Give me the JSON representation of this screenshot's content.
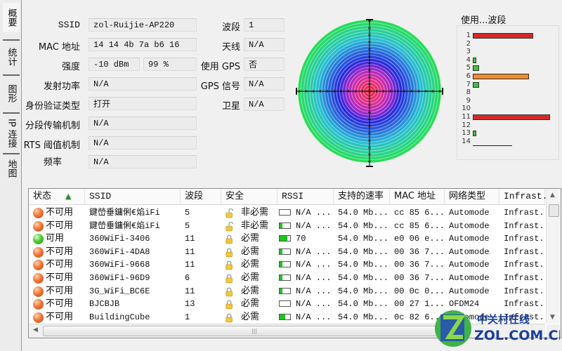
{
  "tabs": [
    {
      "label": "概要",
      "active": true
    },
    {
      "label": "统计",
      "active": false
    },
    {
      "label": "图形",
      "active": false
    },
    {
      "label": "IP 连接",
      "active": false
    },
    {
      "label": "地图",
      "active": false
    }
  ],
  "info": {
    "ssid_label": "SSID",
    "ssid": "zol-Ruijie-AP220",
    "mac_label": "MAC 地址",
    "mac": "14 14 4b 7a b6 16",
    "strength_label": "强度",
    "strength_dbm": "-10 dBm",
    "strength_pct": "99 %",
    "tx_label": "发射功率",
    "tx": "N/A",
    "auth_label": "身份验证类型",
    "auth": "打开",
    "frag_label": "分段传输机制",
    "frag": "N/A",
    "rts_label": "RTS 阈值机制",
    "rts": "N/A",
    "freq_label": "频率",
    "freq": "N/A",
    "channel_label": "波段",
    "channel": "1",
    "antenna_label": "天线",
    "antenna": "N/A",
    "gps_label": "使用 GPS",
    "gps": "否",
    "gps_signal_label": "GPS 信号",
    "gps_signal": "N/A",
    "sat_label": "卫星",
    "sat": "N/A"
  },
  "channel_usage": {
    "title": "使用...波段",
    "channels": [
      {
        "ch": "1",
        "usage": 0.55,
        "color": "#d62828"
      },
      {
        "ch": "2",
        "usage": 0,
        "color": ""
      },
      {
        "ch": "3",
        "usage": 0,
        "color": ""
      },
      {
        "ch": "4",
        "usage": 0.02,
        "color": "#3fc23f"
      },
      {
        "ch": "5",
        "usage": 0.06,
        "color": "#3fc23f"
      },
      {
        "ch": "6",
        "usage": 0.51,
        "color": "#ef8c2c"
      },
      {
        "ch": "7",
        "usage": 0.06,
        "color": "#3fc23f"
      },
      {
        "ch": "8",
        "usage": 0,
        "color": ""
      },
      {
        "ch": "9",
        "usage": 0,
        "color": ""
      },
      {
        "ch": "10",
        "usage": 0,
        "color": ""
      },
      {
        "ch": "11",
        "usage": 0.7,
        "color": "#d62828"
      },
      {
        "ch": "12",
        "usage": 0,
        "color": ""
      },
      {
        "ch": "13",
        "usage": 0.02,
        "color": "#3fc23f"
      },
      {
        "ch": "14",
        "usage": 0,
        "color": ""
      }
    ]
  },
  "list": {
    "columns": [
      "状态",
      "SSID",
      "波段",
      "安全",
      "RSSI",
      "支持的速率",
      "MAC 地址",
      "网络类型",
      "Infrast..."
    ],
    "sort_icon": "sort-ascending-icon",
    "rows": [
      {
        "status": "不可用",
        "ok": false,
        "ssid": "鍵嵤垂鏞俐€焰iFi",
        "channel": "5",
        "secure": false,
        "security": "非必需",
        "rssi_level": 0.0,
        "rssi": "N/A ...",
        "rate": "54.0 Mb...",
        "mac": "cc 85 6...",
        "nettype": "Automode",
        "infra": "Infrast..."
      },
      {
        "status": "不可用",
        "ok": false,
        "ssid": "鍵嵤垂鏞俐€焰iFi",
        "channel": "5",
        "secure": false,
        "security": "非必需",
        "rssi_level": 0.25,
        "rssi": "N/A ...",
        "rate": "54.0 Mb...",
        "mac": "cc 85 6...",
        "nettype": "Automode",
        "infra": "Infrast..."
      },
      {
        "status": "可用",
        "ok": true,
        "ssid": "360WiFi-3406",
        "channel": "11",
        "secure": true,
        "security": "必需",
        "rssi_level": 0.75,
        "rssi": "70",
        "rate": "54.0 Mb...",
        "mac": "e0 06 e...",
        "nettype": "Automode",
        "infra": "Infrast..."
      },
      {
        "status": "不可用",
        "ok": false,
        "ssid": "360WiFi-4DA8",
        "channel": "11",
        "secure": true,
        "security": "必需",
        "rssi_level": 0.25,
        "rssi": "N/A ...",
        "rate": "54.0 Mb...",
        "mac": "00 36 7...",
        "nettype": "Automode",
        "infra": "Infrast..."
      },
      {
        "status": "不可用",
        "ok": false,
        "ssid": "360WiFi-9668",
        "channel": "11",
        "secure": true,
        "security": "必需",
        "rssi_level": 0.25,
        "rssi": "N/A ...",
        "rate": "54.0 Mb...",
        "mac": "00 36 7...",
        "nettype": "Automode",
        "infra": "Infrast..."
      },
      {
        "status": "不可用",
        "ok": false,
        "ssid": "360WiFi-96D9",
        "channel": "6",
        "secure": true,
        "security": "必需",
        "rssi_level": 0.25,
        "rssi": "N/A ...",
        "rate": "54.0 Mb...",
        "mac": "00 36 7...",
        "nettype": "Automode",
        "infra": "Infrast..."
      },
      {
        "status": "不可用",
        "ok": false,
        "ssid": "3G_WiFi_BC6E",
        "channel": "11",
        "secure": true,
        "security": "必需",
        "rssi_level": 0.25,
        "rssi": "N/A ...",
        "rate": "54.0 Mb...",
        "mac": "00 0c 0...",
        "nettype": "Automode",
        "infra": "Infrast..."
      },
      {
        "status": "不可用",
        "ok": false,
        "ssid": "BJCBJB",
        "channel": "13",
        "secure": true,
        "security": "必需",
        "rssi_level": 0.0,
        "rssi": "N/A ...",
        "rate": "54.0 Mb...",
        "mac": "00 27 1...",
        "nettype": "OFDM24",
        "infra": "Infrast..."
      },
      {
        "status": "不可用",
        "ok": false,
        "ssid": "BuildingCube",
        "channel": "1",
        "secure": true,
        "security": "必需",
        "rssi_level": 0.5,
        "rssi": "N/A ...",
        "rate": "54.0 Mb...",
        "mac": "0c 82 6...",
        "nettype": "Automode",
        "infra": "Infrast..."
      }
    ]
  },
  "watermark": {
    "cn": "中关村在线",
    "en": "ZOL.COM.CN"
  }
}
